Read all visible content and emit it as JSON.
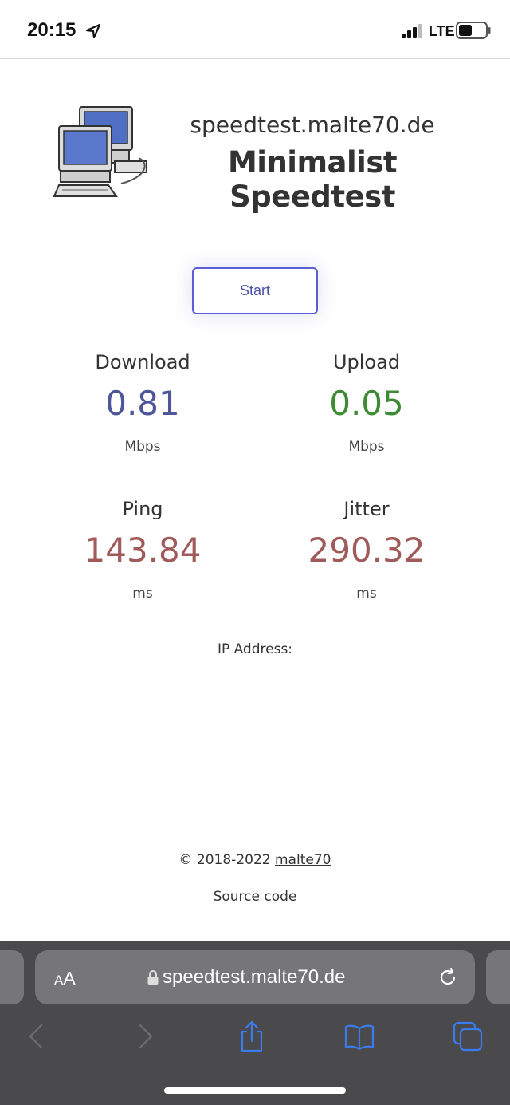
{
  "status_bar": {
    "time": "20:15",
    "network": "LTE"
  },
  "header": {
    "site_name": "speedtest.malte70.de",
    "title": "Minimalist Speedtest"
  },
  "start_label": "Start",
  "metrics": {
    "download": {
      "label": "Download",
      "value": "0.81",
      "unit": "Mbps"
    },
    "upload": {
      "label": "Upload",
      "value": "0.05",
      "unit": "Mbps"
    },
    "ping": {
      "label": "Ping",
      "value": "143.84",
      "unit": "ms"
    },
    "jitter": {
      "label": "Jitter",
      "value": "290.32",
      "unit": "ms"
    }
  },
  "ip_label": "IP Address:",
  "footer": {
    "copyright": "© 2018-2022 ",
    "author_link": "malte70",
    "source_link": "Source code"
  },
  "browser": {
    "aa_small": "A",
    "aa_big": "A",
    "url": "speedtest.malte70.de"
  },
  "colors": {
    "download": "#4e5598",
    "upload": "#3f8a35",
    "ping": "#a05a5a",
    "button_border": "#5a5fd6",
    "toolbar_icons": "#3a7bf0"
  }
}
